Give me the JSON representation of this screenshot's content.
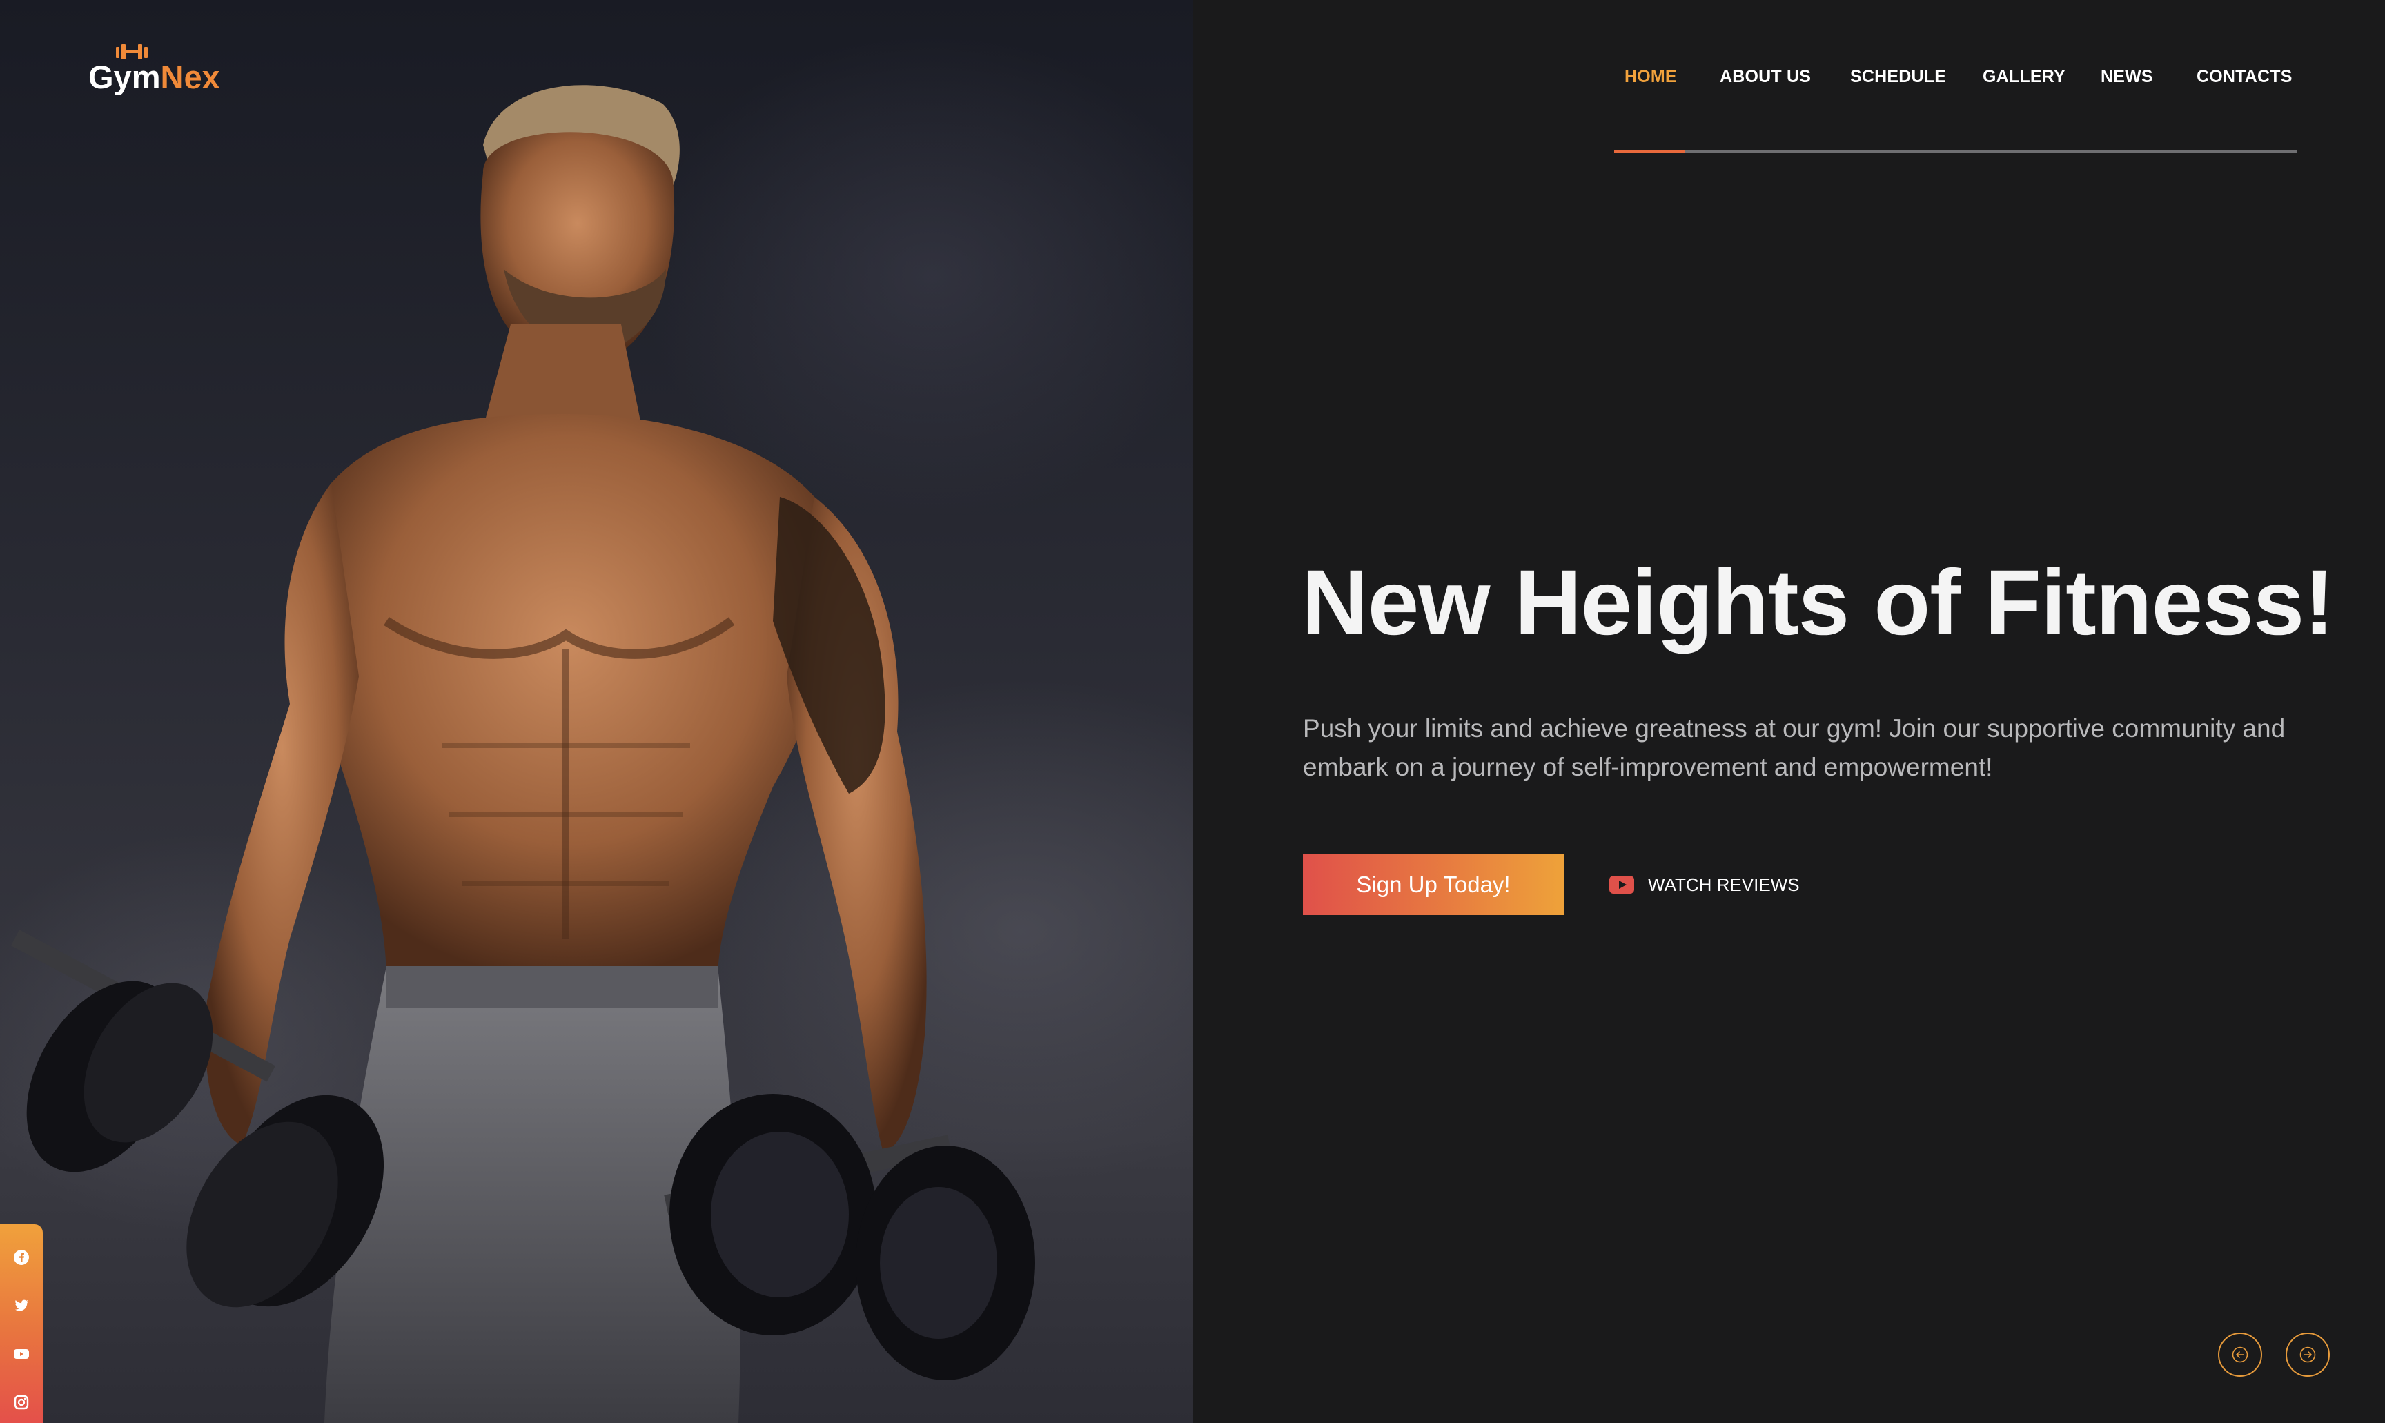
{
  "brand": {
    "name_part1": "Gym",
    "name_part2": "Nex",
    "accent": "#f08a39"
  },
  "nav": {
    "items": [
      {
        "label": "HOME",
        "active": true
      },
      {
        "label": "ABOUT US",
        "active": false
      },
      {
        "label": "SCHEDULE",
        "active": false
      },
      {
        "label": "GALLERY",
        "active": false
      },
      {
        "label": "NEWS",
        "active": false
      },
      {
        "label": "CONTACTS",
        "active": false
      }
    ]
  },
  "hero": {
    "headline": "New Heights of Fitness!",
    "paragraph": "Push your limits and achieve greatness at our gym! Join our supportive community and embark on a journey of self-improvement and empowerment!",
    "cta_label": "Sign Up Today!",
    "watch_label": "WATCH REVIEWS",
    "image_icon": "athlete-photo"
  },
  "social": {
    "icons": [
      "facebook-icon",
      "twitter-icon",
      "youtube-icon",
      "instagram-icon"
    ]
  },
  "slider": {
    "prev_icon": "arrow-left-circle-icon",
    "next_icon": "arrow-right-circle-icon"
  },
  "colors": {
    "background": "#1a1a1b",
    "accent_orange": "#f0a13c",
    "accent_red": "#e0514a",
    "text_muted": "#b9b9bb"
  }
}
